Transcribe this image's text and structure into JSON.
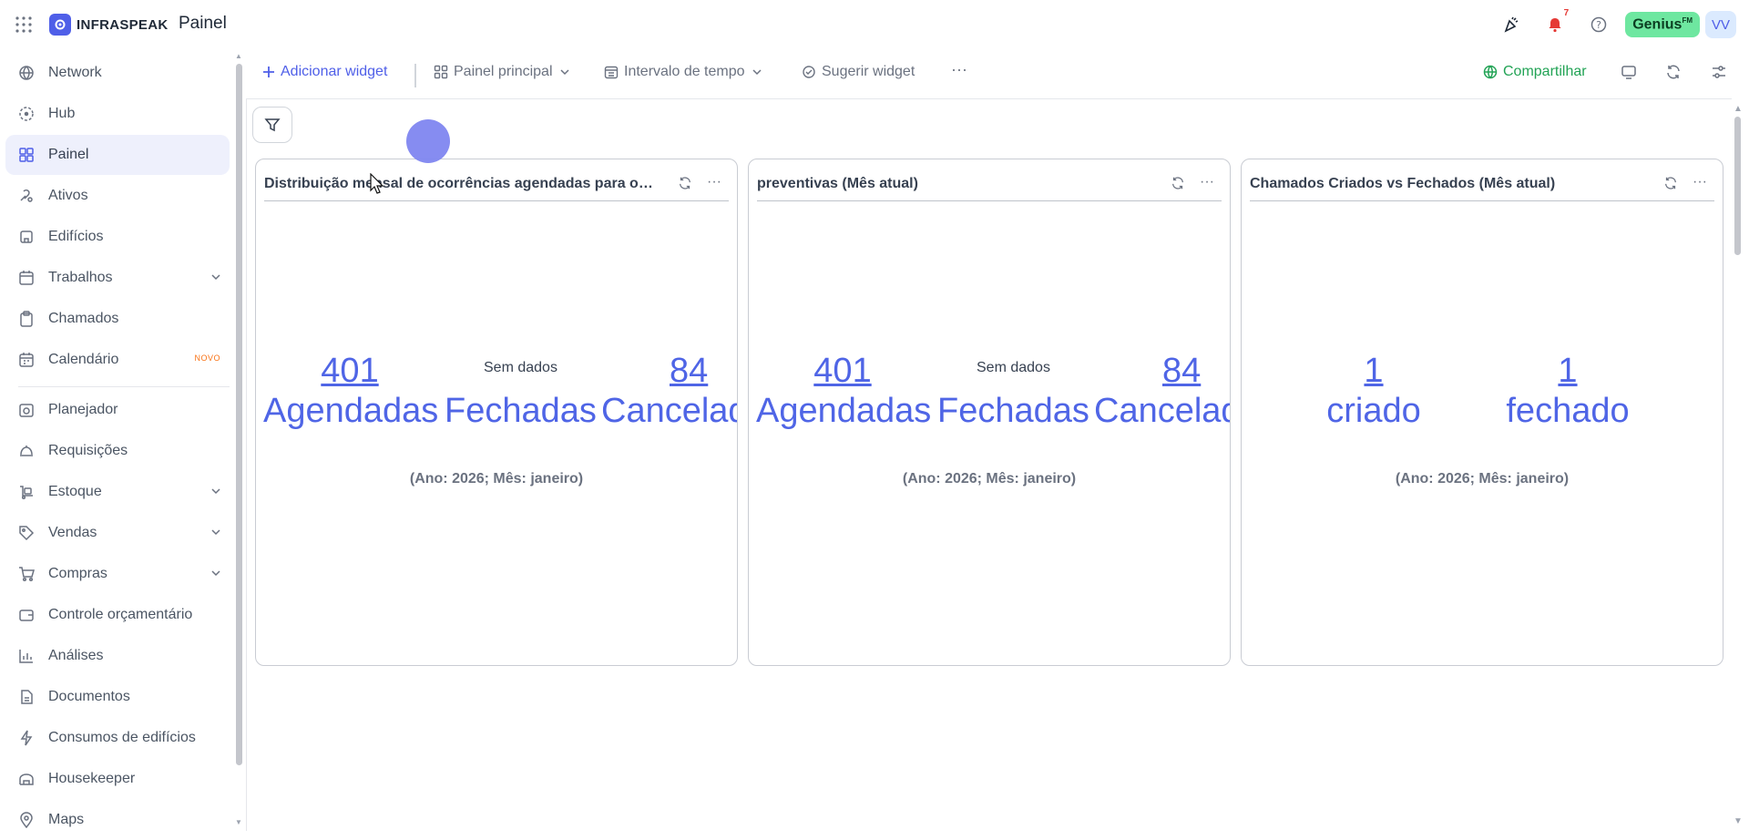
{
  "app": {
    "logo_text": "INFRASPEAK",
    "page_title": "Painel"
  },
  "header": {
    "notification_count": "7",
    "genius_label": "Genius",
    "genius_suffix": "FM",
    "avatar_initials": "VV"
  },
  "sidebar": {
    "items": [
      {
        "label": "Network",
        "icon": "network-icon"
      },
      {
        "label": "Hub",
        "icon": "hub-icon"
      },
      {
        "label": "Painel",
        "icon": "dashboard-icon",
        "active": true
      },
      {
        "label": "Ativos",
        "icon": "assets-icon"
      },
      {
        "label": "Edifícios",
        "icon": "building-icon"
      },
      {
        "label": "Trabalhos",
        "icon": "calendar-work-icon",
        "expandable": true
      },
      {
        "label": "Chamados",
        "icon": "clipboard-icon"
      },
      {
        "label": "Calendário",
        "icon": "calendar-icon",
        "badge": "NOVO"
      },
      {
        "label": "Planejador",
        "icon": "planner-icon"
      },
      {
        "label": "Requisições",
        "icon": "bell-service-icon"
      },
      {
        "label": "Estoque",
        "icon": "stock-icon",
        "expandable": true
      },
      {
        "label": "Vendas",
        "icon": "tag-icon",
        "expandable": true
      },
      {
        "label": "Compras",
        "icon": "cart-icon",
        "expandable": true
      },
      {
        "label": "Controle orçamentário",
        "icon": "wallet-icon"
      },
      {
        "label": "Análises",
        "icon": "chart-icon"
      },
      {
        "label": "Documentos",
        "icon": "document-icon"
      },
      {
        "label": "Consumos de edifícios",
        "icon": "lightning-icon"
      },
      {
        "label": "Housekeeper",
        "icon": "housekeeper-icon"
      },
      {
        "label": "Maps",
        "icon": "map-pin-icon"
      }
    ]
  },
  "toolbar": {
    "add_widget": "Adicionar widget",
    "dashboard_select": "Painel principal",
    "time_interval": "Intervalo de tempo",
    "suggest_widget": "Sugerir widget",
    "share": "Compartilhar"
  },
  "cards": [
    {
      "title": "Distribuição mensal de ocorrências agendadas para o i...",
      "no_data": "Sem dados",
      "stats": [
        {
          "value": "401",
          "label": "Agendadas"
        },
        {
          "value": "",
          "label": "Fechadas"
        },
        {
          "value": "84",
          "label": "Cancelad"
        }
      ],
      "period": "(Ano: 2026; Mês: janeiro)"
    },
    {
      "title": "preventivas (Mês atual)",
      "no_data": "Sem dados",
      "stats": [
        {
          "value": "401",
          "label": "Agendadas"
        },
        {
          "value": "",
          "label": "Fechadas"
        },
        {
          "value": "84",
          "label": "Cancelad"
        }
      ],
      "period": "(Ano: 2026; Mês: janeiro)"
    },
    {
      "title": "Chamados Criados vs Fechados (Mês atual)",
      "stats": [
        {
          "value": "1",
          "label": "criado"
        },
        {
          "value": "1",
          "label": "fechado"
        }
      ],
      "period": "(Ano: 2026; Mês: janeiro)"
    }
  ],
  "colors": {
    "accent": "#4f5fe8",
    "stat_blue": "#4f65e6",
    "share_green": "#22a355",
    "genius_green": "#6ee7a0",
    "alert_red": "#e53935",
    "active_bg": "#eef0fc"
  }
}
